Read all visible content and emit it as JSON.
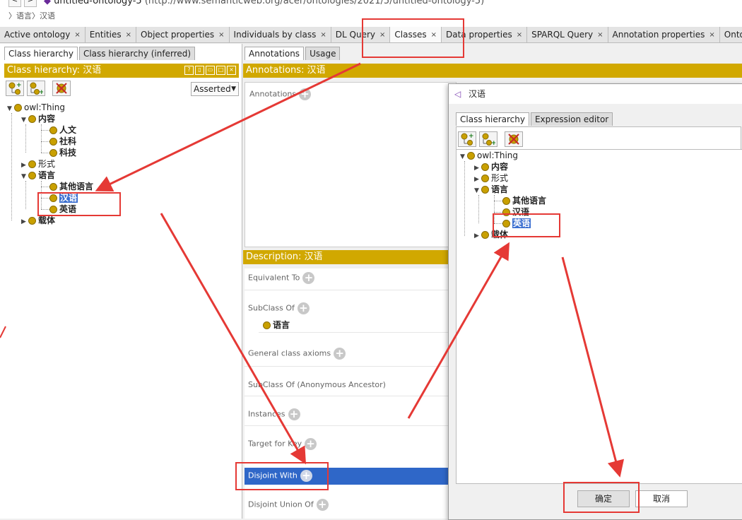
{
  "window": {
    "title": "untitled-ontology-5",
    "uri": "(http://www.semanticweb.org/acer/ontologies/2021/5/untitled-ontology-5)",
    "breadcrumb": "〉语言〉汉语"
  },
  "tabs": [
    {
      "label": "Active ontology"
    },
    {
      "label": "Entities"
    },
    {
      "label": "Object properties"
    },
    {
      "label": "Individuals by class"
    },
    {
      "label": "DL Query"
    },
    {
      "label": "Classes"
    },
    {
      "label": "Data properties"
    },
    {
      "label": "SPARQL Query"
    },
    {
      "label": "Annotation properties"
    },
    {
      "label": "OntoGra"
    }
  ],
  "tab_close": "×",
  "left": {
    "subtab1": "Class hierarchy",
    "subtab2": "Class hierarchy (inferred)",
    "header": "Class hierarchy: 汉语",
    "asserted": "Asserted",
    "tree": {
      "root": "owl:Thing",
      "n1": "内容",
      "n1a": "人文",
      "n1b": "社科",
      "n1c": "科技",
      "n2": "形式",
      "n3": "语言",
      "n3a": "其他语言",
      "n3b": "汉语",
      "n3c": "英语",
      "n4": "载体"
    }
  },
  "middle": {
    "subtab1": "Annotations",
    "subtab2": "Usage",
    "annotations_header": "Annotations: 汉语",
    "annotations_label": "Annotations",
    "description_header": "Description: 汉语",
    "equivalent_to": "Equivalent To",
    "subclass_of": "SubClass Of",
    "subclass_value": "语言",
    "general_axioms": "General class axioms",
    "anon_ancestor": "SubClass Of (Anonymous Ancestor)",
    "instances": "Instances",
    "target_for_key": "Target for Key",
    "disjoint_with": "Disjoint With",
    "disjoint_union": "Disjoint Union Of"
  },
  "dialog": {
    "title": "汉语",
    "subtab1": "Class hierarchy",
    "subtab2": "Expression editor",
    "tree": {
      "root": "owl:Thing",
      "n1": "内容",
      "n2": "形式",
      "n3": "语言",
      "n3a": "其他语言",
      "n3b": "汉语",
      "n3c": "英语",
      "n4": "载体"
    },
    "ok": "确定",
    "cancel": "取消"
  },
  "colors": {
    "header_yellow": "#d1a800",
    "selection_blue": "#3a6ed0",
    "annotation_red": "#e53935"
  }
}
